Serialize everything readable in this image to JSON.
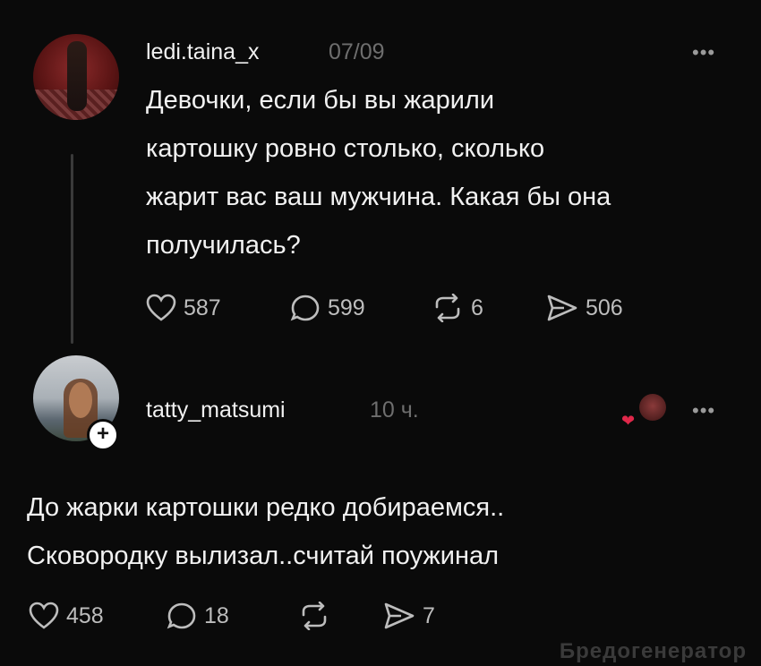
{
  "post": {
    "username": "ledi.taina_x",
    "time": "07/09",
    "text_lines": [
      "Девочки, если бы вы жарили",
      "картошку ровно столько, сколько",
      "жарит вас ваш мужчина. Какая бы она",
      "получилась?"
    ],
    "likes": "587",
    "comments": "599",
    "reposts": "6",
    "shares": "506"
  },
  "reply": {
    "username": "tatty_matsumi",
    "time": "10 ч.",
    "text_lines": [
      "До жарки картошки редко добираемся..",
      "Сковородку вылизал..считай поужинал"
    ],
    "likes": "458",
    "comments": "18",
    "shares": "7"
  },
  "more_label": "•••",
  "follow_label": "+",
  "watermark": "Бредогенератор",
  "colors": {
    "background": "#0a0a0a",
    "text": "#f1f1f1",
    "muted": "#6e6e6e",
    "heart": "#e0284a"
  }
}
